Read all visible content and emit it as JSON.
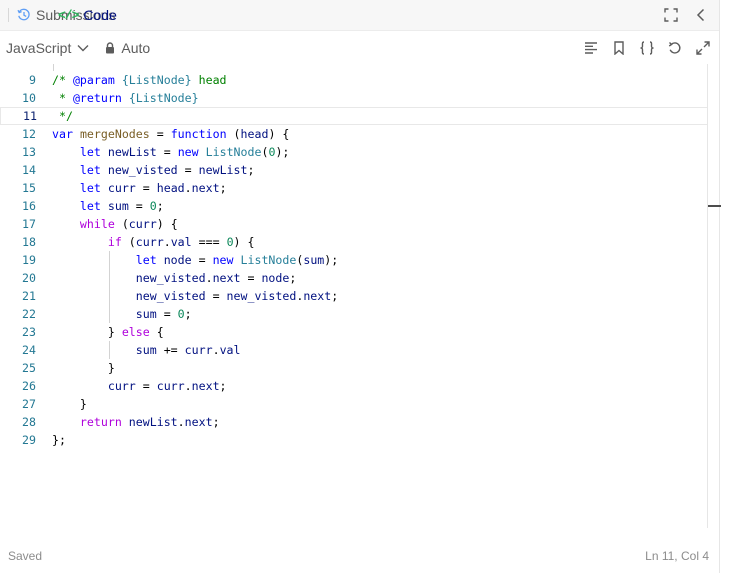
{
  "tabs": {
    "code_label": "Code",
    "code_icon": "</>",
    "submissions_label": "Submissions"
  },
  "toolbar": {
    "language": "JavaScript",
    "mode": "Auto"
  },
  "colors": {
    "accent_green": "#2db55d",
    "keyword": "#0000ff",
    "control": "#af00db",
    "number": "#098658",
    "comment": "#008000"
  },
  "editor": {
    "partial_top_line": "/",
    "lines": [
      {
        "n": "9",
        "text": " * @param {ListNode} head"
      },
      {
        "n": "10",
        "text": " * @return {ListNode}"
      },
      {
        "n": "11",
        "text": " */"
      },
      {
        "n": "12",
        "text": "var mergeNodes = function (head) {"
      },
      {
        "n": "13",
        "text": "    let newList = new ListNode(0);"
      },
      {
        "n": "14",
        "text": "    let new_visted = newList;"
      },
      {
        "n": "15",
        "text": "    let curr = head.next;"
      },
      {
        "n": "16",
        "text": "    let sum = 0;"
      },
      {
        "n": "17",
        "text": "    while (curr) {"
      },
      {
        "n": "18",
        "text": "        if (curr.val === 0) {"
      },
      {
        "n": "19",
        "text": "            let node = new ListNode(sum);"
      },
      {
        "n": "20",
        "text": "            new_visted.next = node;"
      },
      {
        "n": "21",
        "text": "            new_visted = new_visted.next;"
      },
      {
        "n": "22",
        "text": "            sum = 0;"
      },
      {
        "n": "23",
        "text": "        } else {"
      },
      {
        "n": "24",
        "text": "            sum += curr.val"
      },
      {
        "n": "25",
        "text": "        }"
      },
      {
        "n": "26",
        "text": "        curr = curr.next;"
      },
      {
        "n": "27",
        "text": "    }"
      },
      {
        "n": "28",
        "text": "    return newList.next;"
      },
      {
        "n": "29",
        "text": "};"
      }
    ]
  },
  "footer": {
    "status": "Saved",
    "cursor": "Ln 11, Col 4"
  }
}
